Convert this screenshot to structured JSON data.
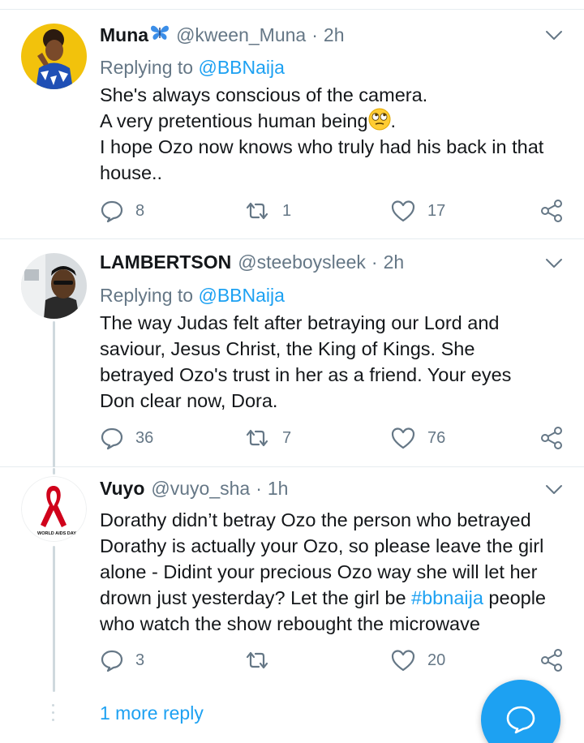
{
  "tweets": [
    {
      "name": "Muna",
      "handle": "@kween_Muna",
      "separator": "·",
      "time": "2h",
      "replying_prefix": "Replying to",
      "replying_to": "@BBNaija",
      "lines": [
        "She's always conscious of the camera.",
        "A very pretentious human being",
        "I hope Ozo now knows who truly had his back in that house.."
      ],
      "line2_suffix": ".",
      "replies": "8",
      "retweets": "1",
      "likes": "17",
      "name_emoji": "butterfly-icon",
      "body_emoji": "face-with-rolling-eyes-icon"
    },
    {
      "name": "LAMBERTSON",
      "handle": "@steeboysleek",
      "separator": "·",
      "time": "2h",
      "replying_prefix": "Replying to",
      "replying_to": "@BBNaija",
      "text": "The way Judas felt after betraying our Lord and saviour, Jesus Christ, the King of Kings. She betrayed Ozo's trust in her as a friend. Your eyes Don clear now, Dora.",
      "replies": "36",
      "retweets": "7",
      "likes": "76"
    },
    {
      "name": "Vuyo",
      "handle": "@vuyo_sha",
      "separator": "·",
      "time": "1h",
      "text_before_tag": "Dorathy didn’t betray Ozo the person who betrayed Dorathy is actually your Ozo, so please leave the girl alone - Didint your precious Ozo way she will let her drown just yesterday? Let the girl be ",
      "hashtag": "#bbnaija",
      "text_after_tag": " people who watch the show rebought the microwave",
      "replies": "3",
      "retweets": "",
      "likes": "20",
      "avatar_text": "WORLD AIDS DAY"
    }
  ],
  "more_reply": "1 more reply",
  "colors": {
    "accent": "#1da1f2",
    "secondary_text": "#657786",
    "divider": "#e6ecf0",
    "aids_ribbon": "#d0021b"
  }
}
